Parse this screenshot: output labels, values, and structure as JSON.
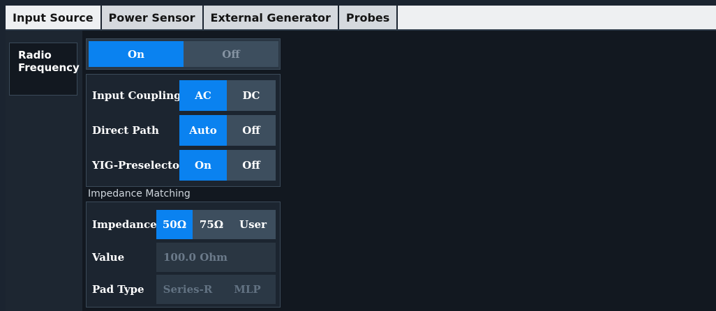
{
  "tabs": [
    {
      "label": "Input Source",
      "active": true
    },
    {
      "label": "Power Sensor",
      "active": false
    },
    {
      "label": "External Generator",
      "active": false
    },
    {
      "label": "Probes",
      "active": false
    }
  ],
  "sidebar": {
    "items": [
      {
        "label": "Radio Frequency",
        "selected": true
      }
    ]
  },
  "rf_toggle": {
    "on_label": "On",
    "off_label": "Off",
    "selected": "On"
  },
  "settings": {
    "input_coupling": {
      "label": "Input Coupling",
      "options": [
        "AC",
        "DC"
      ],
      "selected": "AC"
    },
    "direct_path": {
      "label": "Direct Path",
      "options": [
        "Auto",
        "Off"
      ],
      "selected": "Auto"
    },
    "yig_preselector": {
      "label": "YIG-Preselector",
      "options": [
        "On",
        "Off"
      ],
      "selected": "On"
    }
  },
  "impedance_matching": {
    "title": "Impedance Matching",
    "impedance": {
      "label": "Impedance",
      "options": [
        "50Ω",
        "75Ω",
        "User"
      ],
      "selected": "50Ω"
    },
    "value": {
      "label": "Value",
      "value": "100.0 Ohm",
      "enabled": false
    },
    "pad_type": {
      "label": "Pad Type",
      "options": [
        "Series-R",
        "MLP"
      ],
      "enabled": false
    }
  },
  "colors": {
    "accent": "#0a82f0",
    "background": "#121820",
    "tab_bg": "#d5d9de"
  }
}
